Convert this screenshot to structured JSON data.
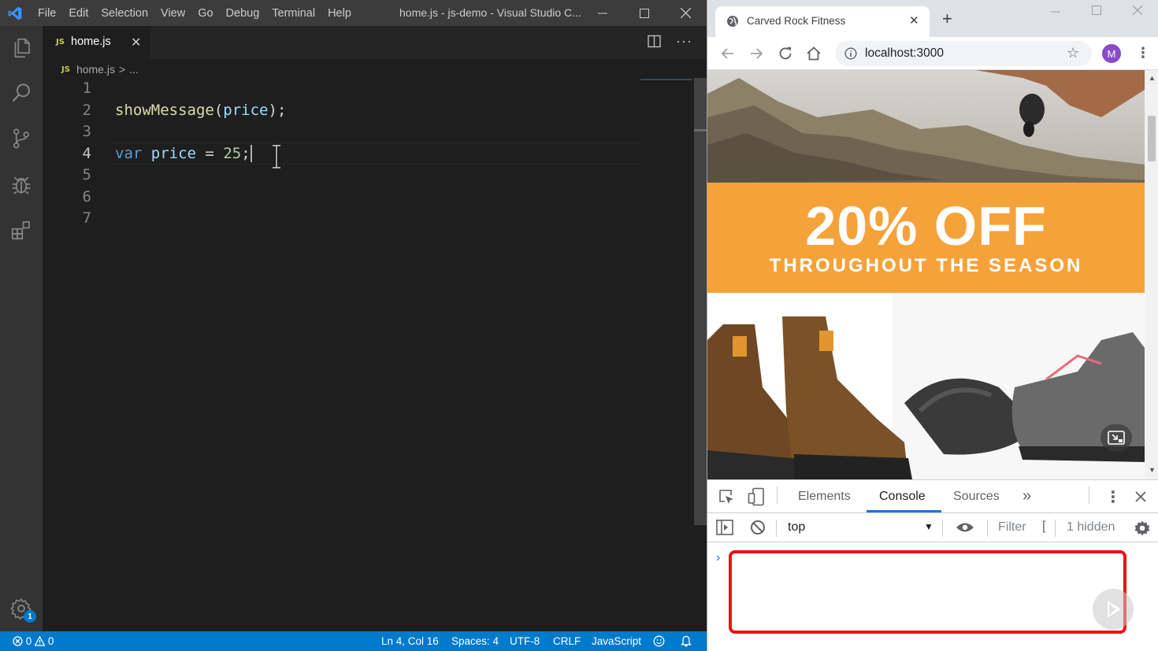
{
  "vscode": {
    "menu": [
      "File",
      "Edit",
      "Selection",
      "View",
      "Go",
      "Debug",
      "Terminal",
      "Help"
    ],
    "window_title": "home.js - js-demo - Visual Studio C...",
    "tab": {
      "icon": "JS",
      "label": "home.js"
    },
    "breadcrumb": {
      "icon": "JS",
      "file": "home.js",
      "separator": ">",
      "rest": "..."
    },
    "code_lines": [
      {
        "num": "1"
      },
      {
        "num": "2",
        "fn": "showMessage",
        "open": "(",
        "arg": "price",
        "close": ");"
      },
      {
        "num": "3"
      },
      {
        "num": "4",
        "kw": "var",
        "varname": "price",
        "op": " = ",
        "value": "25",
        "end": ";"
      },
      {
        "num": "5"
      },
      {
        "num": "6"
      },
      {
        "num": "7"
      }
    ],
    "activity_badge": "1",
    "status": {
      "errors": "0",
      "warnings": "0",
      "position": "Ln 4, Col 16",
      "spaces": "Spaces: 4",
      "encoding": "UTF-8",
      "eol": "CRLF",
      "language": "JavaScript"
    }
  },
  "chrome": {
    "tab_title": "Carved Rock Fitness",
    "url": "localhost:3000",
    "avatar_letter": "M",
    "page": {
      "banner_big": "20% OFF",
      "banner_small": "THROUGHOUT THE SEASON",
      "banner_color": "#f6a23a"
    },
    "devtools": {
      "tabs": [
        "Elements",
        "Console",
        "Sources"
      ],
      "more": "»",
      "context": "top",
      "filter_placeholder": "Filter",
      "filter_bracket": "[",
      "hidden_count": "1 hidden"
    }
  }
}
